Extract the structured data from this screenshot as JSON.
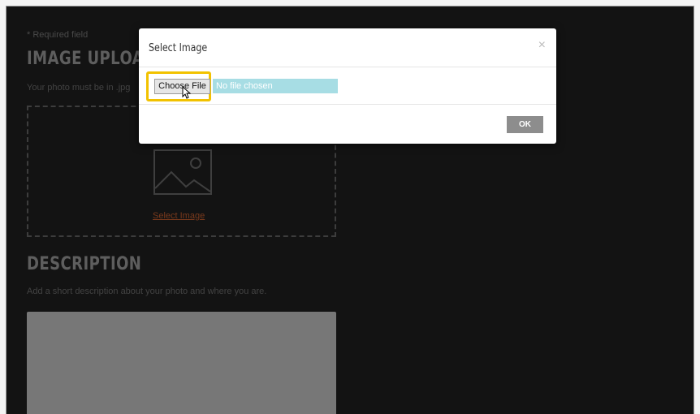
{
  "page": {
    "required_note": "* Required field",
    "image_upload_heading": "IMAGE UPLOAD",
    "format_note": "Your photo must be in .jpg",
    "select_image_link": "Select Image",
    "description_heading": "DESCRIPTION",
    "description_hint": "Add a short description about your photo and where you are."
  },
  "modal": {
    "title": "Select Image",
    "close_glyph": "×",
    "choose_file_label": "Choose File",
    "file_status": "No file chosen",
    "ok_label": "OK"
  },
  "colors": {
    "page_bg": "#131313",
    "highlight": "#f2c200",
    "file_status_bg": "#a7dde4",
    "ok_button": "#8d8d8d",
    "link": "#7a3a1c"
  },
  "icons": [
    "image-placeholder-icon",
    "close-icon",
    "pointer-cursor-icon"
  ]
}
